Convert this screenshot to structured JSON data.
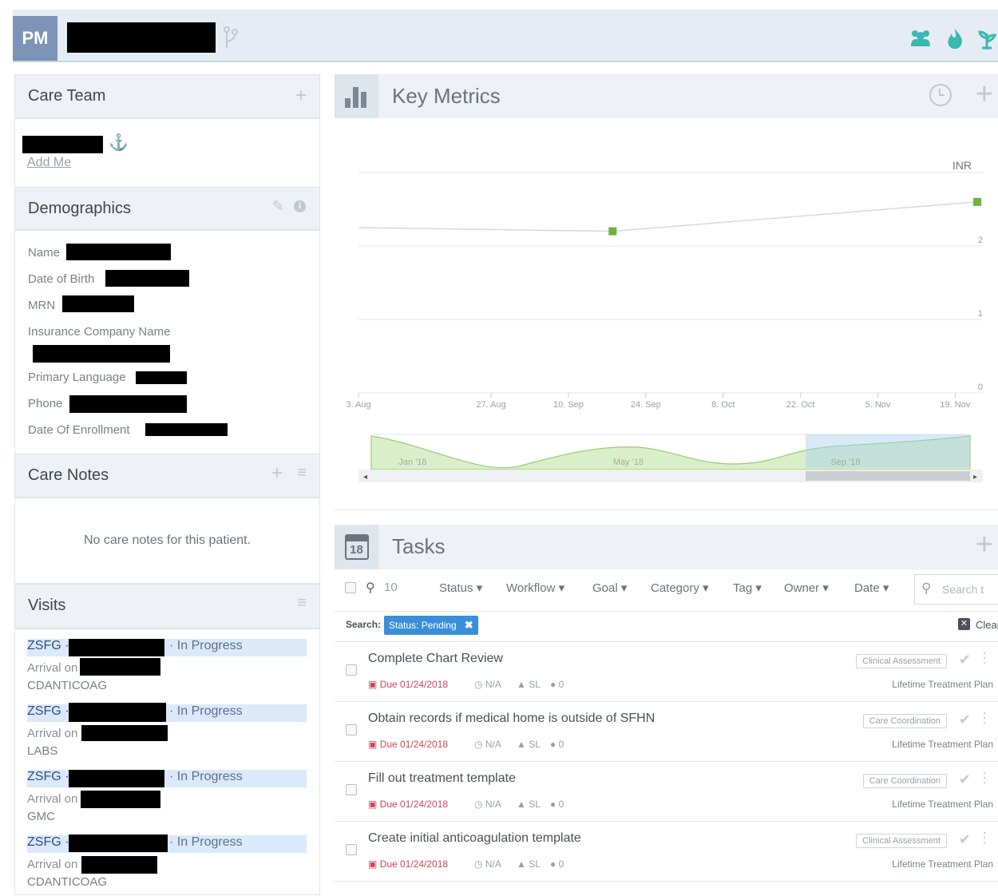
{
  "header": {
    "logo": "PM",
    "icons": [
      "branch-icon",
      "team-icon",
      "flame-icon",
      "plant-icon"
    ]
  },
  "care_team": {
    "title": "Care Team",
    "add_me": "Add Me"
  },
  "demographics": {
    "title": "Demographics",
    "labels": [
      "Name",
      "Date of Birth",
      "MRN",
      "Insurance Company Name",
      "Primary Language",
      "Phone",
      "Date Of Enrollment"
    ]
  },
  "care_notes": {
    "title": "Care Notes",
    "empty": "No care notes for this patient."
  },
  "visits": {
    "title": "Visits",
    "items": [
      {
        "org": "ZSFG ·",
        "status": "· In Progress",
        "arrival": "Arrival on",
        "dept": "CDANTICOAG"
      },
      {
        "org": "ZSFG ·",
        "status": "· In Progress",
        "arrival": "Arrival on",
        "dept": "LABS"
      },
      {
        "org": "ZSFG ·",
        "status": "· In Progress",
        "arrival": "Arrival on",
        "dept": "GMC"
      },
      {
        "org": "ZSFG ·",
        "status": "· In Progress",
        "arrival": "Arrival on",
        "dept": "CDANTICOAG"
      }
    ]
  },
  "key_metrics": {
    "title": "Key Metrics"
  },
  "chart_data": {
    "type": "line",
    "title": "",
    "series": [
      {
        "name": "INR",
        "x": [
          "2018-09-18",
          "2018-11-23"
        ],
        "values": [
          2.2,
          2.6
        ]
      }
    ],
    "x_ticks": [
      "3. Aug",
      "27. Aug",
      "10. Sep",
      "24. Sep",
      "8. Oct",
      "22. Oct",
      "5. Nov",
      "19. Nov"
    ],
    "y_ticks": [
      "0",
      "1",
      "2"
    ],
    "ylim": [
      0,
      3
    ],
    "navigator_labels": [
      "Jan '18",
      "May '18",
      "Sep '18"
    ],
    "grid": true
  },
  "tasks": {
    "title": "Tasks",
    "calendar_day": "18",
    "count": "10",
    "filters": [
      "Status ▾",
      "Workflow ▾",
      "Goal ▾",
      "Category ▾",
      "Tag ▾",
      "Owner ▾",
      "Date ▾"
    ],
    "search_placeholder": "Search t",
    "search_label": "Search:",
    "active_filter": "Status: Pending",
    "clear_label": "Clear",
    "items": [
      {
        "title": "Complete Chart Review",
        "due": "Due 01/24/2018",
        "na": "N/A",
        "owner": "SL",
        "comments": "0",
        "tag": "Clinical Assessment",
        "plan": "Lifetime Treatment Plan"
      },
      {
        "title": "Obtain records if medical home is outside of SFHN",
        "due": "Due 01/24/2018",
        "na": "N/A",
        "owner": "SL",
        "comments": "0",
        "tag": "Care Coordination",
        "plan": "Lifetime Treatment Plan"
      },
      {
        "title": "Fill out treatment template",
        "due": "Due 01/24/2018",
        "na": "N/A",
        "owner": "SL",
        "comments": "0",
        "tag": "Care Coordination",
        "plan": "Lifetime Treatment Plan"
      },
      {
        "title": "Create initial anticoagulation template",
        "due": "Due 01/24/2018",
        "na": "N/A",
        "owner": "SL",
        "comments": "0",
        "tag": "Clinical Assessment",
        "plan": "Lifetime Treatment Plan"
      }
    ]
  }
}
